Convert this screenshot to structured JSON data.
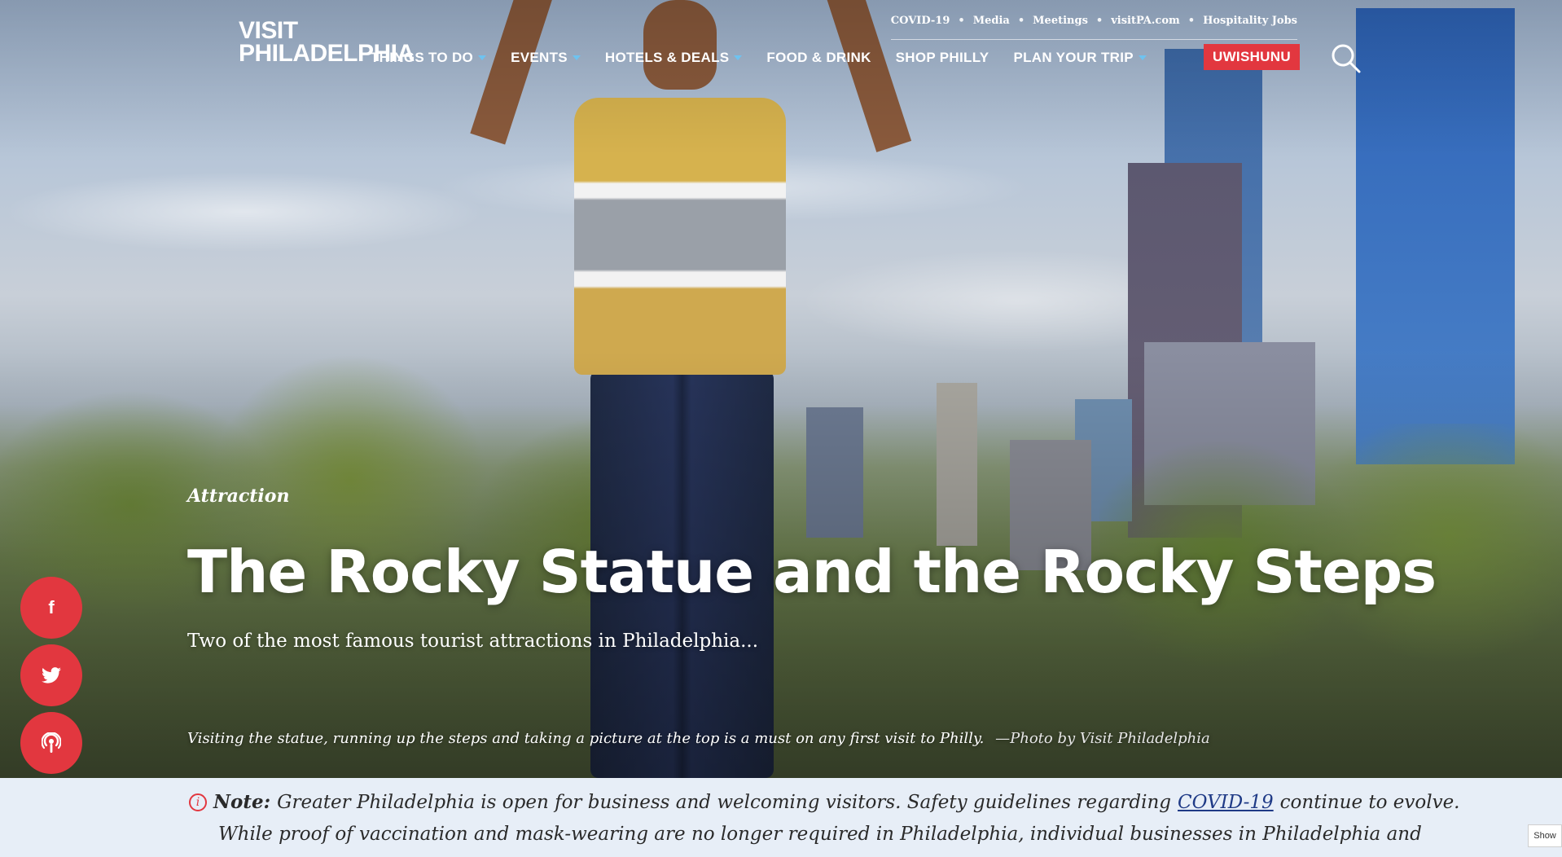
{
  "brand": {
    "line1": "VISIT",
    "line2": "PHILADELPHIA"
  },
  "utility_nav": [
    "COVID-19",
    "Media",
    "Meetings",
    "visitPA.com",
    "Hospitality Jobs"
  ],
  "main_nav": [
    {
      "label": "THINGS TO DO",
      "has_dropdown": true
    },
    {
      "label": "EVENTS",
      "has_dropdown": true
    },
    {
      "label": "HOTELS & DEALS",
      "has_dropdown": true
    },
    {
      "label": "FOOD & DRINK",
      "has_dropdown": false
    },
    {
      "label": "SHOP PHILLY",
      "has_dropdown": false
    },
    {
      "label": "PLAN YOUR TRIP",
      "has_dropdown": true
    }
  ],
  "cta": {
    "label": "UWISHUNU"
  },
  "search": {
    "icon": "search-icon"
  },
  "hero": {
    "kicker": "Attraction",
    "title": "The Rocky Statue and the Rocky Steps",
    "subtitle": "Two of the most famous tourist attractions in Philadelphia...",
    "caption": "Visiting the statue, running up the steps and taking a picture at the top is a must on any first visit to Philly.",
    "credit": "—Photo by Visit Philadelphia"
  },
  "social": [
    {
      "icon": "facebook-icon",
      "glyph": "f"
    },
    {
      "icon": "twitter-icon"
    },
    {
      "icon": "podcast-icon"
    }
  ],
  "accessibility": {
    "icon": "accessibility-icon"
  },
  "note": {
    "label": "Note:",
    "text_before_link": "Greater Philadelphia is open for business and welcoming visitors. Safety guidelines regarding",
    "link": "COVID-19",
    "text_after_link": "continue to evolve.",
    "line2": "While proof of vaccination and mask-wearing are no longer required in Philadelphia, individual businesses in Philadelphia and"
  },
  "show_tab": {
    "label": "Show"
  },
  "colors": {
    "accent_red": "#e2373f",
    "note_bg": "#e7eef7",
    "link_blue": "#1f3a86",
    "caret_blue": "#6ec3f0"
  }
}
